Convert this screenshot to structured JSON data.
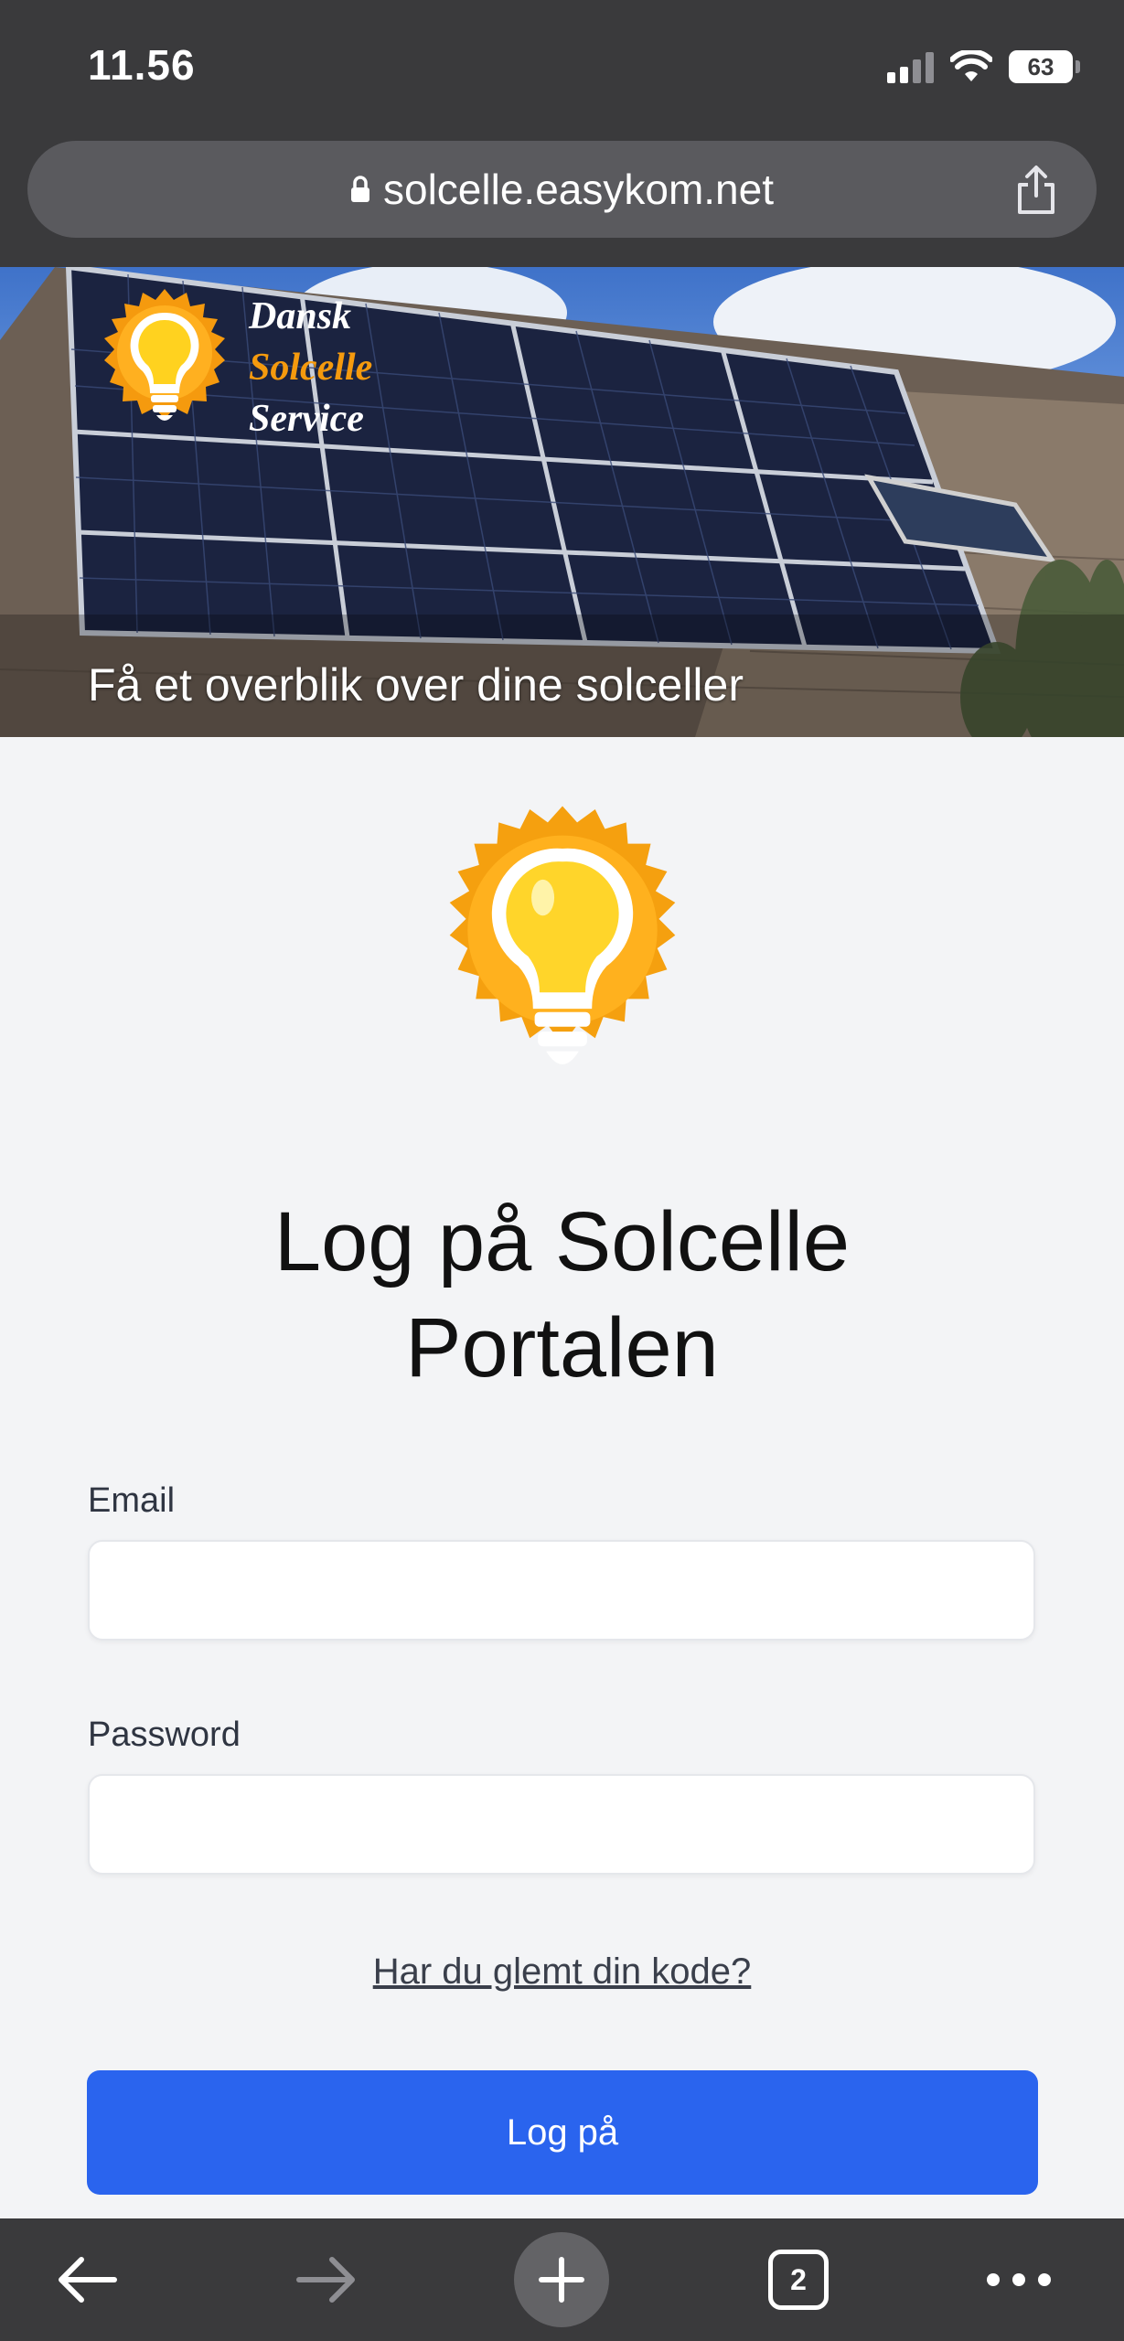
{
  "status_bar": {
    "time": "11.56",
    "battery_level": "63"
  },
  "browser": {
    "url": "solcelle.easykom.net",
    "open_tab_count": "2"
  },
  "hero": {
    "brand_line_1": "Dansk",
    "brand_line_2": "Solcelle",
    "brand_line_3": "Service",
    "tagline": "Få et overblik over dine solceller"
  },
  "login": {
    "title_line_1": "Log på Solcelle",
    "title_line_2": "Portalen",
    "email_label": "Email",
    "email_value": "",
    "password_label": "Password",
    "password_value": "",
    "forgot_link": "Har du glemt din kode?",
    "submit_label": "Log på"
  },
  "colors": {
    "primary_button": "#2a64ee",
    "brand_orange": "#f59a0e",
    "bulb_yellow": "#ffd21f",
    "chrome_dark": "#3a3a3c"
  },
  "icons": [
    "lock-icon",
    "share-icon",
    "signal-icon",
    "wifi-icon",
    "battery-icon",
    "back-arrow-icon",
    "forward-arrow-icon",
    "plus-icon",
    "tabs-icon",
    "more-icon",
    "lightbulb-sun-logo"
  ]
}
